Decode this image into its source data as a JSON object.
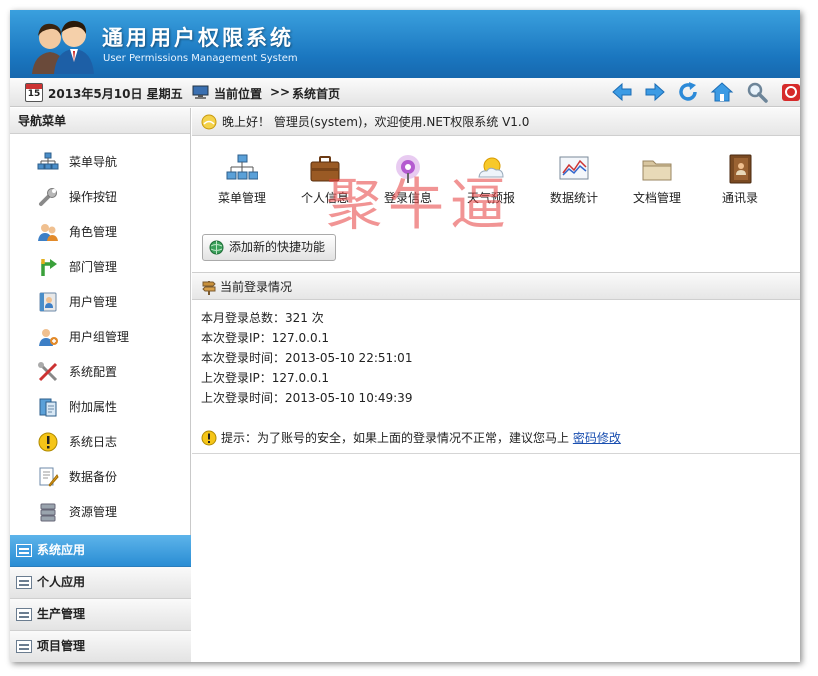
{
  "header": {
    "title": "通用用户权限系统",
    "subtitle": "User Permissions Management System"
  },
  "toolbar": {
    "calendar_day": "15",
    "date": "2013年5月10日 星期五",
    "location_label": "当前位置",
    "separator": ">>",
    "current_page": "系统首页",
    "buttons": [
      "back-icon",
      "forward-icon",
      "refresh-icon",
      "home-icon",
      "search-icon",
      "exit-icon"
    ]
  },
  "sidebar": {
    "title": "导航菜单",
    "items": [
      {
        "label": "菜单导航",
        "icon": "sitemap-icon"
      },
      {
        "label": "操作按钮",
        "icon": "wrench-icon"
      },
      {
        "label": "角色管理",
        "icon": "users-icon"
      },
      {
        "label": "部门管理",
        "icon": "branch-arrow-icon"
      },
      {
        "label": "用户管理",
        "icon": "user-card-icon"
      },
      {
        "label": "用户组管理",
        "icon": "user-group-icon"
      },
      {
        "label": "系统配置",
        "icon": "tools-icon"
      },
      {
        "label": "附加属性",
        "icon": "attribute-book-icon"
      },
      {
        "label": "系统日志",
        "icon": "warning-icon"
      },
      {
        "label": "数据备份",
        "icon": "backup-edit-icon"
      },
      {
        "label": "资源管理",
        "icon": "database-icon"
      }
    ],
    "sections": [
      {
        "label": "系统应用",
        "active": true
      },
      {
        "label": "个人应用",
        "active": false
      },
      {
        "label": "生产管理",
        "active": false
      },
      {
        "label": "项目管理",
        "active": false
      }
    ]
  },
  "main": {
    "welcome": "晚上好！ 管理员(system)，欢迎使用.NET权限系统 V1.0",
    "shortcuts": [
      {
        "label": "菜单管理",
        "icon": "sitemap-icon"
      },
      {
        "label": "个人信息",
        "icon": "briefcase-icon"
      },
      {
        "label": "登录信息",
        "icon": "signal-icon"
      },
      {
        "label": "天气预报",
        "icon": "weather-icon"
      },
      {
        "label": "数据统计",
        "icon": "chart-icon"
      },
      {
        "label": "文档管理",
        "icon": "folder-icon"
      },
      {
        "label": "通讯录",
        "icon": "address-book-icon"
      }
    ],
    "add_shortcut": "添加新的快捷功能",
    "login_section_title": "当前登录情况",
    "stats": [
      "本月登录总数：321 次",
      "本次登录IP：127.0.0.1",
      "本次登录时间：2013-05-10 22:51:01",
      "上次登录IP：127.0.0.1",
      "上次登录时间：2013-05-10 10:49:39"
    ],
    "tip_text": "提示：为了账号的安全，如果上面的登录情况不正常，建议您马上",
    "tip_link": "密码修改"
  },
  "watermark": "聚牛逼"
}
